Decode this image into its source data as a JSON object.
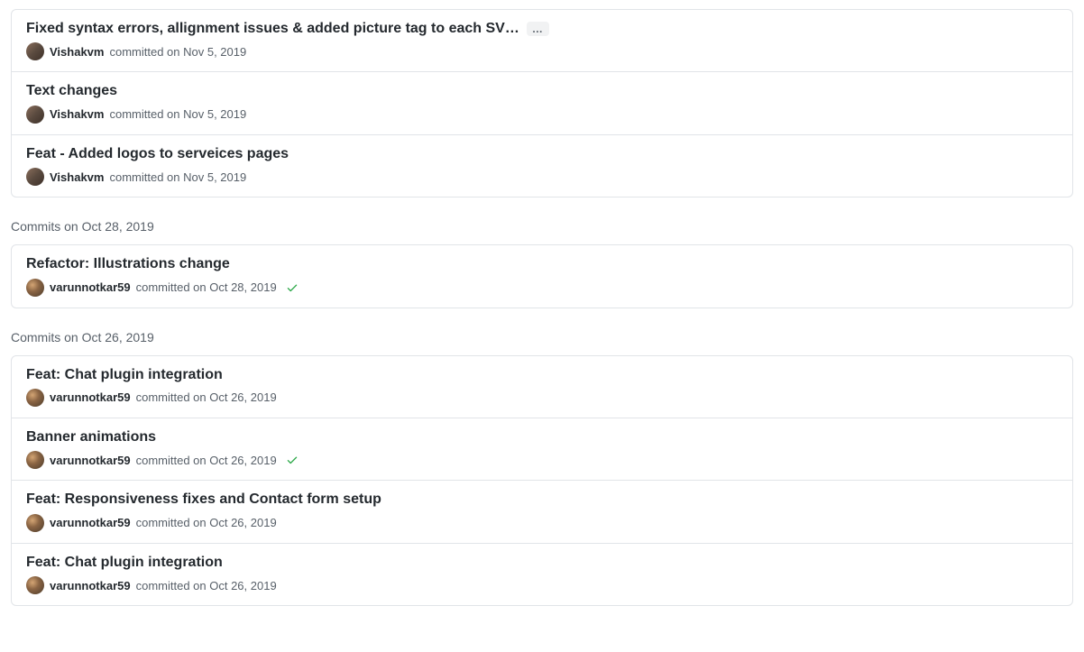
{
  "text": {
    "committed_on": "committed on",
    "ellipsis": "…"
  },
  "groups": [
    {
      "header": null,
      "commits": [
        {
          "title": "Fixed syntax errors, allignment issues & added picture tag to each SV…",
          "show_ellipsis": true,
          "avatar_class": "avatar-vishak",
          "author": "Vishakvm",
          "date": "Nov 5, 2019",
          "checkmark": false
        },
        {
          "title": "Text changes",
          "show_ellipsis": false,
          "avatar_class": "avatar-vishak",
          "author": "Vishakvm",
          "date": "Nov 5, 2019",
          "checkmark": false
        },
        {
          "title": "Feat - Added logos to serveices pages",
          "show_ellipsis": false,
          "avatar_class": "avatar-vishak",
          "author": "Vishakvm",
          "date": "Nov 5, 2019",
          "checkmark": false
        }
      ]
    },
    {
      "header": "Commits on Oct 28, 2019",
      "commits": [
        {
          "title": "Refactor: Illustrations change",
          "show_ellipsis": false,
          "avatar_class": "avatar-varun",
          "author": "varunnotkar59",
          "date": "Oct 28, 2019",
          "checkmark": true
        }
      ]
    },
    {
      "header": "Commits on Oct 26, 2019",
      "commits": [
        {
          "title": "Feat: Chat plugin integration",
          "show_ellipsis": false,
          "avatar_class": "avatar-varun",
          "author": "varunnotkar59",
          "date": "Oct 26, 2019",
          "checkmark": false
        },
        {
          "title": "Banner animations",
          "show_ellipsis": false,
          "avatar_class": "avatar-varun",
          "author": "varunnotkar59",
          "date": "Oct 26, 2019",
          "checkmark": true
        },
        {
          "title": "Feat: Responsiveness fixes and Contact form setup",
          "show_ellipsis": false,
          "avatar_class": "avatar-varun",
          "author": "varunnotkar59",
          "date": "Oct 26, 2019",
          "checkmark": false
        },
        {
          "title": "Feat: Chat plugin integration",
          "show_ellipsis": false,
          "avatar_class": "avatar-varun",
          "author": "varunnotkar59",
          "date": "Oct 26, 2019",
          "checkmark": false
        }
      ]
    }
  ]
}
